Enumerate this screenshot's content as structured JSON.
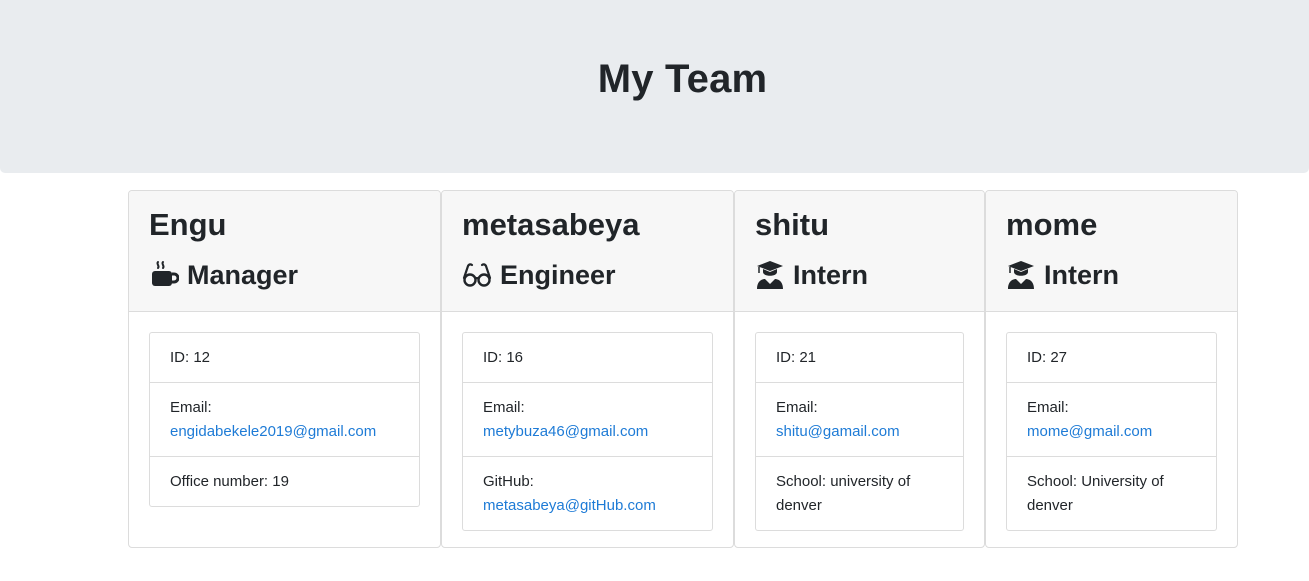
{
  "header": {
    "title": "My Team"
  },
  "employees": [
    {
      "name": "Engu",
      "role": "Manager",
      "icon": "coffee-icon",
      "id_label": "ID: 12",
      "email_label": "Email:",
      "email": "engidabekele2019@gmail.com",
      "extra": "Office number: 19"
    },
    {
      "name": "metasabeya",
      "role": "Engineer",
      "icon": "glasses-icon",
      "id_label": "ID: 16",
      "email_label": "Email:",
      "email": "metybuza46@gmail.com",
      "extra_label": "GitHub:",
      "extra_link": "metasabeya@gitHub.com"
    },
    {
      "name": "shitu",
      "role": "Intern",
      "icon": "graduate-icon",
      "id_label": "ID: 21",
      "email_label": "Email:",
      "email": "shitu@gamail.com",
      "extra": "School: university of denver"
    },
    {
      "name": "mome",
      "role": "Intern",
      "icon": "graduate-icon",
      "id_label": "ID: 27",
      "email_label": "Email:",
      "email": "mome@gmail.com",
      "extra": "School: University of denver"
    }
  ],
  "colors": {
    "header_bg": "#e9ecef",
    "link": "#1e7bd6",
    "card_header_bg": "#f7f7f7"
  }
}
